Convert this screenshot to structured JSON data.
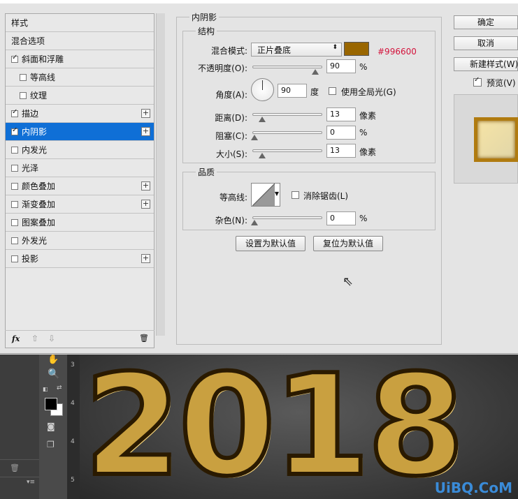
{
  "style_list": {
    "items": [
      {
        "label": "样式",
        "checkbox": false,
        "checked": false,
        "plus": false,
        "selected": false,
        "indent": 0
      },
      {
        "label": "混合选项",
        "checkbox": false,
        "checked": false,
        "plus": false,
        "selected": false,
        "indent": 0
      },
      {
        "label": "斜面和浮雕",
        "checkbox": true,
        "checked": true,
        "plus": false,
        "selected": false,
        "indent": 0
      },
      {
        "label": "等高线",
        "checkbox": true,
        "checked": false,
        "plus": false,
        "selected": false,
        "indent": 1
      },
      {
        "label": "纹理",
        "checkbox": true,
        "checked": false,
        "plus": false,
        "selected": false,
        "indent": 1
      },
      {
        "label": "描边",
        "checkbox": true,
        "checked": true,
        "plus": true,
        "selected": false,
        "indent": 0
      },
      {
        "label": "内阴影",
        "checkbox": true,
        "checked": true,
        "plus": true,
        "selected": true,
        "indent": 0
      },
      {
        "label": "内发光",
        "checkbox": true,
        "checked": false,
        "plus": false,
        "selected": false,
        "indent": 0
      },
      {
        "label": "光泽",
        "checkbox": true,
        "checked": false,
        "plus": false,
        "selected": false,
        "indent": 0
      },
      {
        "label": "颜色叠加",
        "checkbox": true,
        "checked": false,
        "plus": true,
        "selected": false,
        "indent": 0
      },
      {
        "label": "渐变叠加",
        "checkbox": true,
        "checked": false,
        "plus": true,
        "selected": false,
        "indent": 0
      },
      {
        "label": "图案叠加",
        "checkbox": true,
        "checked": false,
        "plus": false,
        "selected": false,
        "indent": 0
      },
      {
        "label": "外发光",
        "checkbox": true,
        "checked": false,
        "plus": false,
        "selected": false,
        "indent": 0
      },
      {
        "label": "投影",
        "checkbox": true,
        "checked": false,
        "plus": true,
        "selected": false,
        "indent": 0
      }
    ],
    "fx_label": "fx",
    "selected_color": "#0f6fd6"
  },
  "inner_shadow": {
    "title": "内阴影",
    "structure": {
      "title": "结构",
      "blend_mode_label": "混合模式:",
      "blend_mode_value": "正片叠底",
      "color_swatch": "#996600",
      "color_hex": "#996600",
      "opacity_label": "不透明度(O):",
      "opacity_value": "90",
      "opacity_unit": "%",
      "angle_label": "角度(A):",
      "angle_value": "90",
      "angle_unit": "度",
      "global_light_label": "使用全局光(G)",
      "global_light_checked": false,
      "distance_label": "距离(D):",
      "distance_value": "13",
      "distance_unit": "像素",
      "choke_label": "阻塞(C):",
      "choke_value": "0",
      "choke_unit": "%",
      "size_label": "大小(S):",
      "size_value": "13",
      "size_unit": "像素"
    },
    "quality": {
      "title": "品质",
      "contour_label": "等高线:",
      "anti_alias_label": "消除锯齿(L)",
      "anti_alias_checked": false,
      "noise_label": "杂色(N):",
      "noise_value": "0",
      "noise_unit": "%"
    },
    "set_default_label": "设置为默认值",
    "reset_default_label": "复位为默认值"
  },
  "side_buttons": {
    "ok": "确定",
    "cancel": "取消",
    "new_style": "新建样式(W)...",
    "preview_label": "预览(V)",
    "preview_checked": true
  },
  "workspace": {
    "canvas_text": "2018",
    "ruler_marks": [
      "3",
      "4",
      "4",
      "5"
    ],
    "watermark": "UiBQ.CoM"
  }
}
